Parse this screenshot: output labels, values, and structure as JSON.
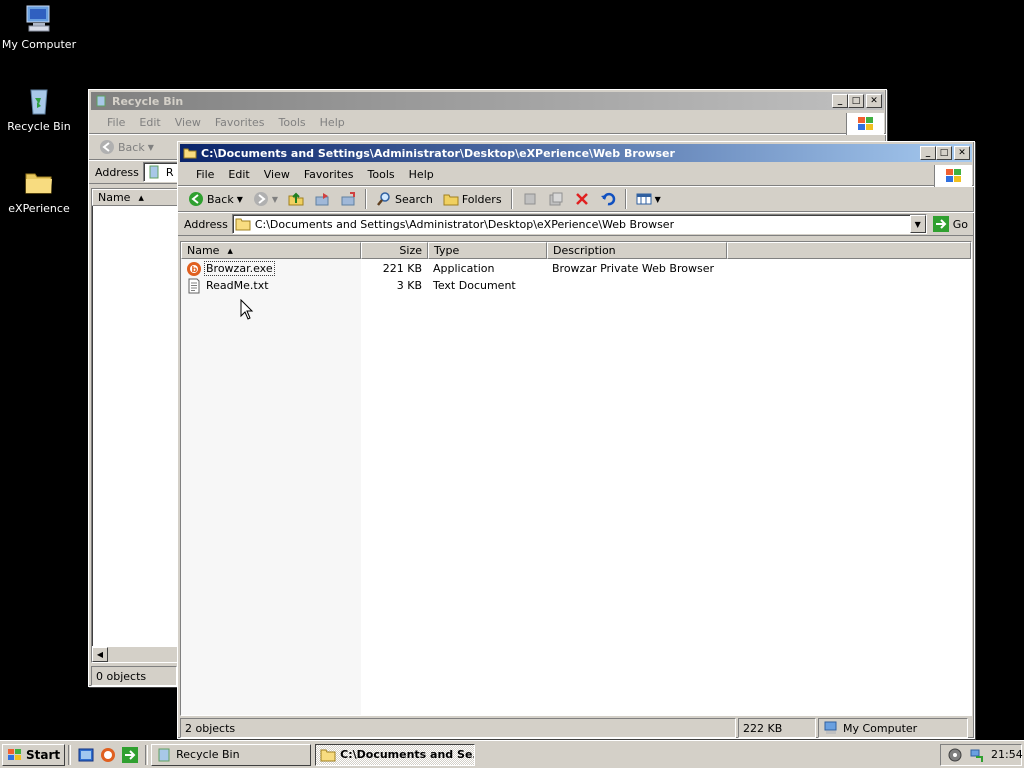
{
  "desktop": {
    "icons": [
      {
        "label": "My Computer",
        "icon": "my-computer-icon"
      },
      {
        "label": "Recycle Bin",
        "icon": "recycle-bin-icon"
      },
      {
        "label": "eXPerience",
        "icon": "folder-icon"
      }
    ]
  },
  "back_window": {
    "title": "Recycle Bin",
    "menus": [
      "File",
      "Edit",
      "View",
      "Favorites",
      "Tools",
      "Help"
    ],
    "back_label": "Back",
    "address_label": "Address",
    "address_value": "R",
    "col_name": "Name",
    "status": "0 objects"
  },
  "front_window": {
    "title": "C:\\Documents and Settings\\Administrator\\Desktop\\eXPerience\\Web Browser",
    "menus": [
      "File",
      "Edit",
      "View",
      "Favorites",
      "Tools",
      "Help"
    ],
    "toolbar": {
      "back": "Back",
      "search": "Search",
      "folders": "Folders"
    },
    "address_label": "Address",
    "address_value": "C:\\Documents and Settings\\Administrator\\Desktop\\eXPerience\\Web Browser",
    "go_label": "Go",
    "columns": [
      "Name",
      "Size",
      "Type",
      "Description"
    ],
    "files": [
      {
        "name": "Browzar.exe",
        "size": "221 KB",
        "type": "Application",
        "description": "Browzar Private Web Browser",
        "icon": "browzar-app-icon"
      },
      {
        "name": "ReadMe.txt",
        "size": "3 KB",
        "type": "Text Document",
        "description": "",
        "icon": "text-document-icon"
      }
    ],
    "status": {
      "objects": "2 objects",
      "size": "222 KB",
      "zone": "My Computer"
    }
  },
  "taskbar": {
    "start": "Start",
    "tasks": [
      "Recycle Bin",
      "C:\\Documents and Se..."
    ],
    "clock": "21:54"
  },
  "colors": {
    "title_active": "#0a246a",
    "title_inactive": "#808080",
    "face": "#d4d0c8",
    "desktop": "#000000"
  }
}
